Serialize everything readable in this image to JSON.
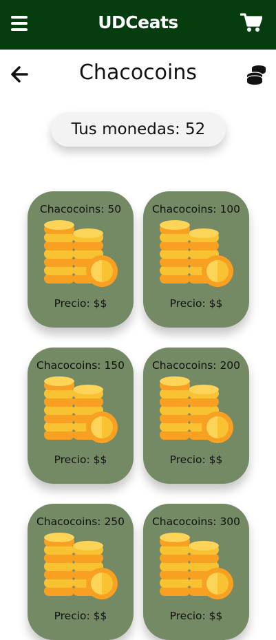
{
  "header": {
    "brand": "UDCeats",
    "menu_icon": "hamburger-menu-icon",
    "cart_icon": "shopping-cart-icon"
  },
  "page": {
    "title": "Chacocoins",
    "back_icon": "arrow-left-icon",
    "coins_icon": "coin-stack-icon"
  },
  "balance": {
    "text": "Tus monedas: 52"
  },
  "packages": [
    {
      "label": "Chacocoins: 50",
      "price": "Precio: $$"
    },
    {
      "label": "Chacocoins: 100",
      "price": "Precio: $$"
    },
    {
      "label": "Chacocoins: 150",
      "price": "Precio: $$"
    },
    {
      "label": "Chacocoins: 200",
      "price": "Precio: $$"
    },
    {
      "label": "Chacocoins: 250",
      "price": "Precio: $$"
    },
    {
      "label": "Chacocoins: 300",
      "price": "Precio: $$"
    }
  ],
  "colors": {
    "header_bg": "#063d0f",
    "card_bg": "#738a65",
    "coin_gold": "#f9c233",
    "coin_orange": "#f7a021"
  }
}
